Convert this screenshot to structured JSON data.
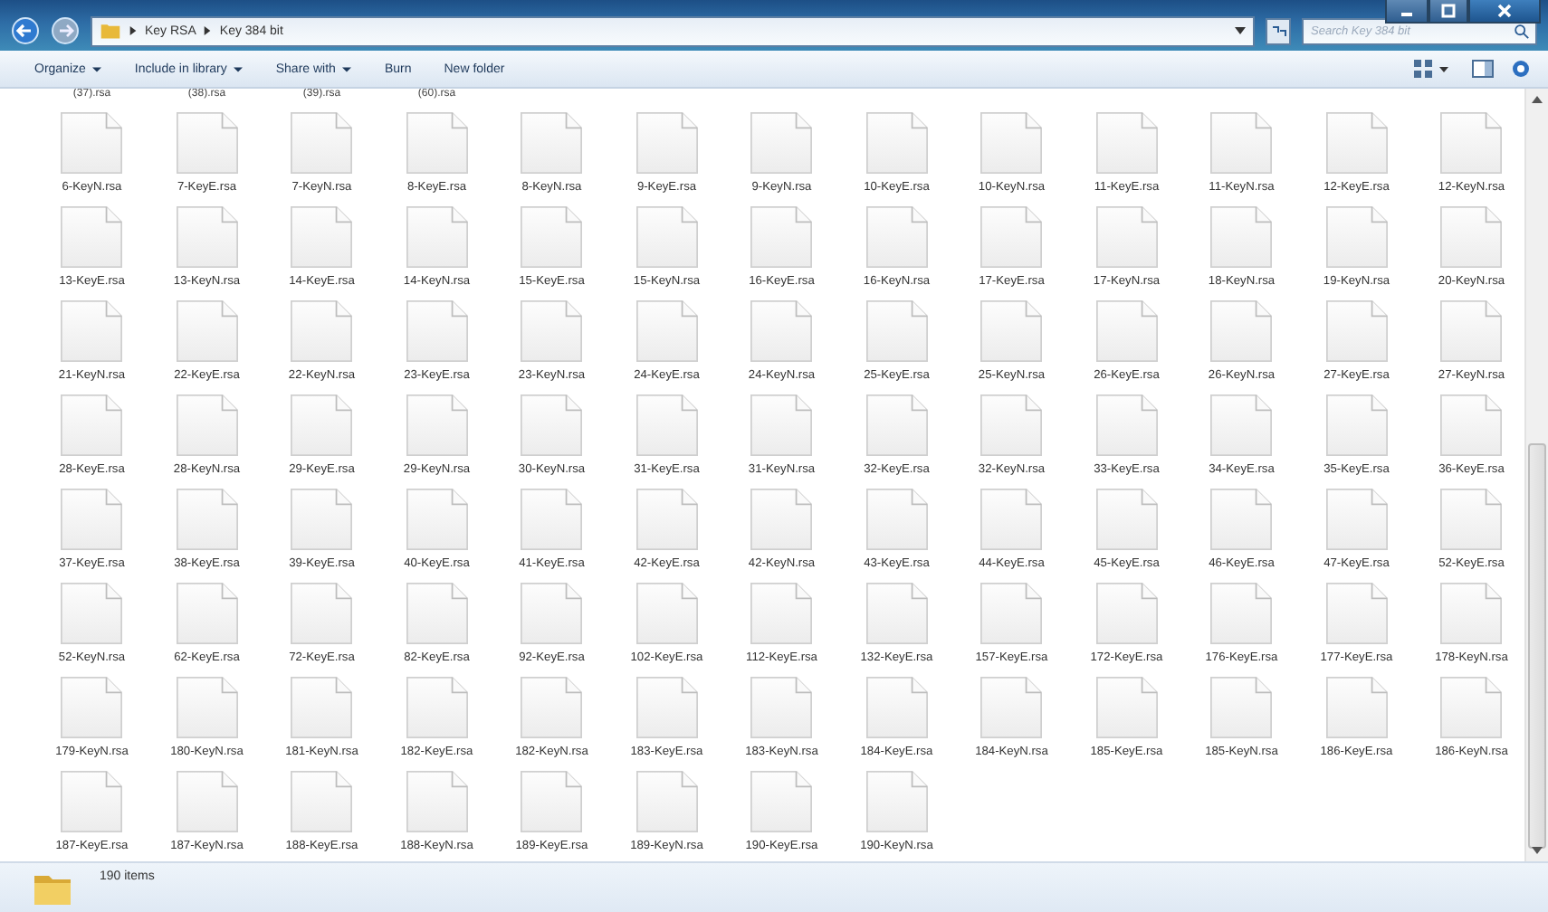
{
  "window": {
    "breadcrumb": [
      "Key RSA",
      "Key 384 bit"
    ],
    "search": {
      "placeholder": "Search Key 384 bit"
    }
  },
  "toolbar": [
    {
      "label": "Organize",
      "dropdown": true
    },
    {
      "label": "Include in library",
      "dropdown": true
    },
    {
      "label": "Share with",
      "dropdown": true
    },
    {
      "label": "Burn",
      "dropdown": false
    },
    {
      "label": "New folder",
      "dropdown": false
    }
  ],
  "partial_labels": [
    "(37).rsa",
    "(38).rsa",
    "(39).rsa",
    "(60).rsa"
  ],
  "files": [
    [
      "6-KeyN.rsa",
      "7-KeyE.rsa",
      "7-KeyN.rsa",
      "8-KeyE.rsa",
      "8-KeyN.rsa",
      "9-KeyE.rsa",
      "9-KeyN.rsa",
      "10-KeyE.rsa",
      "10-KeyN.rsa",
      "11-KeyE.rsa",
      "11-KeyN.rsa",
      "12-KeyE.rsa",
      "12-KeyN.rsa"
    ],
    [
      "13-KeyE.rsa",
      "13-KeyN.rsa",
      "14-KeyE.rsa",
      "14-KeyN.rsa",
      "15-KeyE.rsa",
      "15-KeyN.rsa",
      "16-KeyE.rsa",
      "16-KeyN.rsa",
      "17-KeyE.rsa",
      "17-KeyN.rsa",
      "18-KeyN.rsa",
      "19-KeyN.rsa",
      "20-KeyN.rsa"
    ],
    [
      "21-KeyN.rsa",
      "22-KeyE.rsa",
      "22-KeyN.rsa",
      "23-KeyE.rsa",
      "23-KeyN.rsa",
      "24-KeyE.rsa",
      "24-KeyN.rsa",
      "25-KeyE.rsa",
      "25-KeyN.rsa",
      "26-KeyE.rsa",
      "26-KeyN.rsa",
      "27-KeyE.rsa",
      "27-KeyN.rsa"
    ],
    [
      "28-KeyE.rsa",
      "28-KeyN.rsa",
      "29-KeyE.rsa",
      "29-KeyN.rsa",
      "30-KeyN.rsa",
      "31-KeyE.rsa",
      "31-KeyN.rsa",
      "32-KeyE.rsa",
      "32-KeyN.rsa",
      "33-KeyE.rsa",
      "34-KeyE.rsa",
      "35-KeyE.rsa",
      "36-KeyE.rsa"
    ],
    [
      "37-KeyE.rsa",
      "38-KeyE.rsa",
      "39-KeyE.rsa",
      "40-KeyE.rsa",
      "41-KeyE.rsa",
      "42-KeyE.rsa",
      "42-KeyN.rsa",
      "43-KeyE.rsa",
      "44-KeyE.rsa",
      "45-KeyE.rsa",
      "46-KeyE.rsa",
      "47-KeyE.rsa",
      "52-KeyE.rsa"
    ],
    [
      "52-KeyN.rsa",
      "62-KeyE.rsa",
      "72-KeyE.rsa",
      "82-KeyE.rsa",
      "92-KeyE.rsa",
      "102-KeyE.rsa",
      "112-KeyE.rsa",
      "132-KeyE.rsa",
      "157-KeyE.rsa",
      "172-KeyE.rsa",
      "176-KeyE.rsa",
      "177-KeyE.rsa",
      "178-KeyN.rsa"
    ],
    [
      "179-KeyN.rsa",
      "180-KeyN.rsa",
      "181-KeyN.rsa",
      "182-KeyE.rsa",
      "182-KeyN.rsa",
      "183-KeyE.rsa",
      "183-KeyN.rsa",
      "184-KeyE.rsa",
      "184-KeyN.rsa",
      "185-KeyE.rsa",
      "185-KeyN.rsa",
      "186-KeyE.rsa",
      "186-KeyN.rsa"
    ],
    [
      "187-KeyE.rsa",
      "187-KeyN.rsa",
      "188-KeyE.rsa",
      "188-KeyN.rsa",
      "189-KeyE.rsa",
      "189-KeyN.rsa",
      "190-KeyE.rsa",
      "190-KeyN.rsa"
    ]
  ],
  "status_bar": {
    "item_count": "190 items"
  }
}
